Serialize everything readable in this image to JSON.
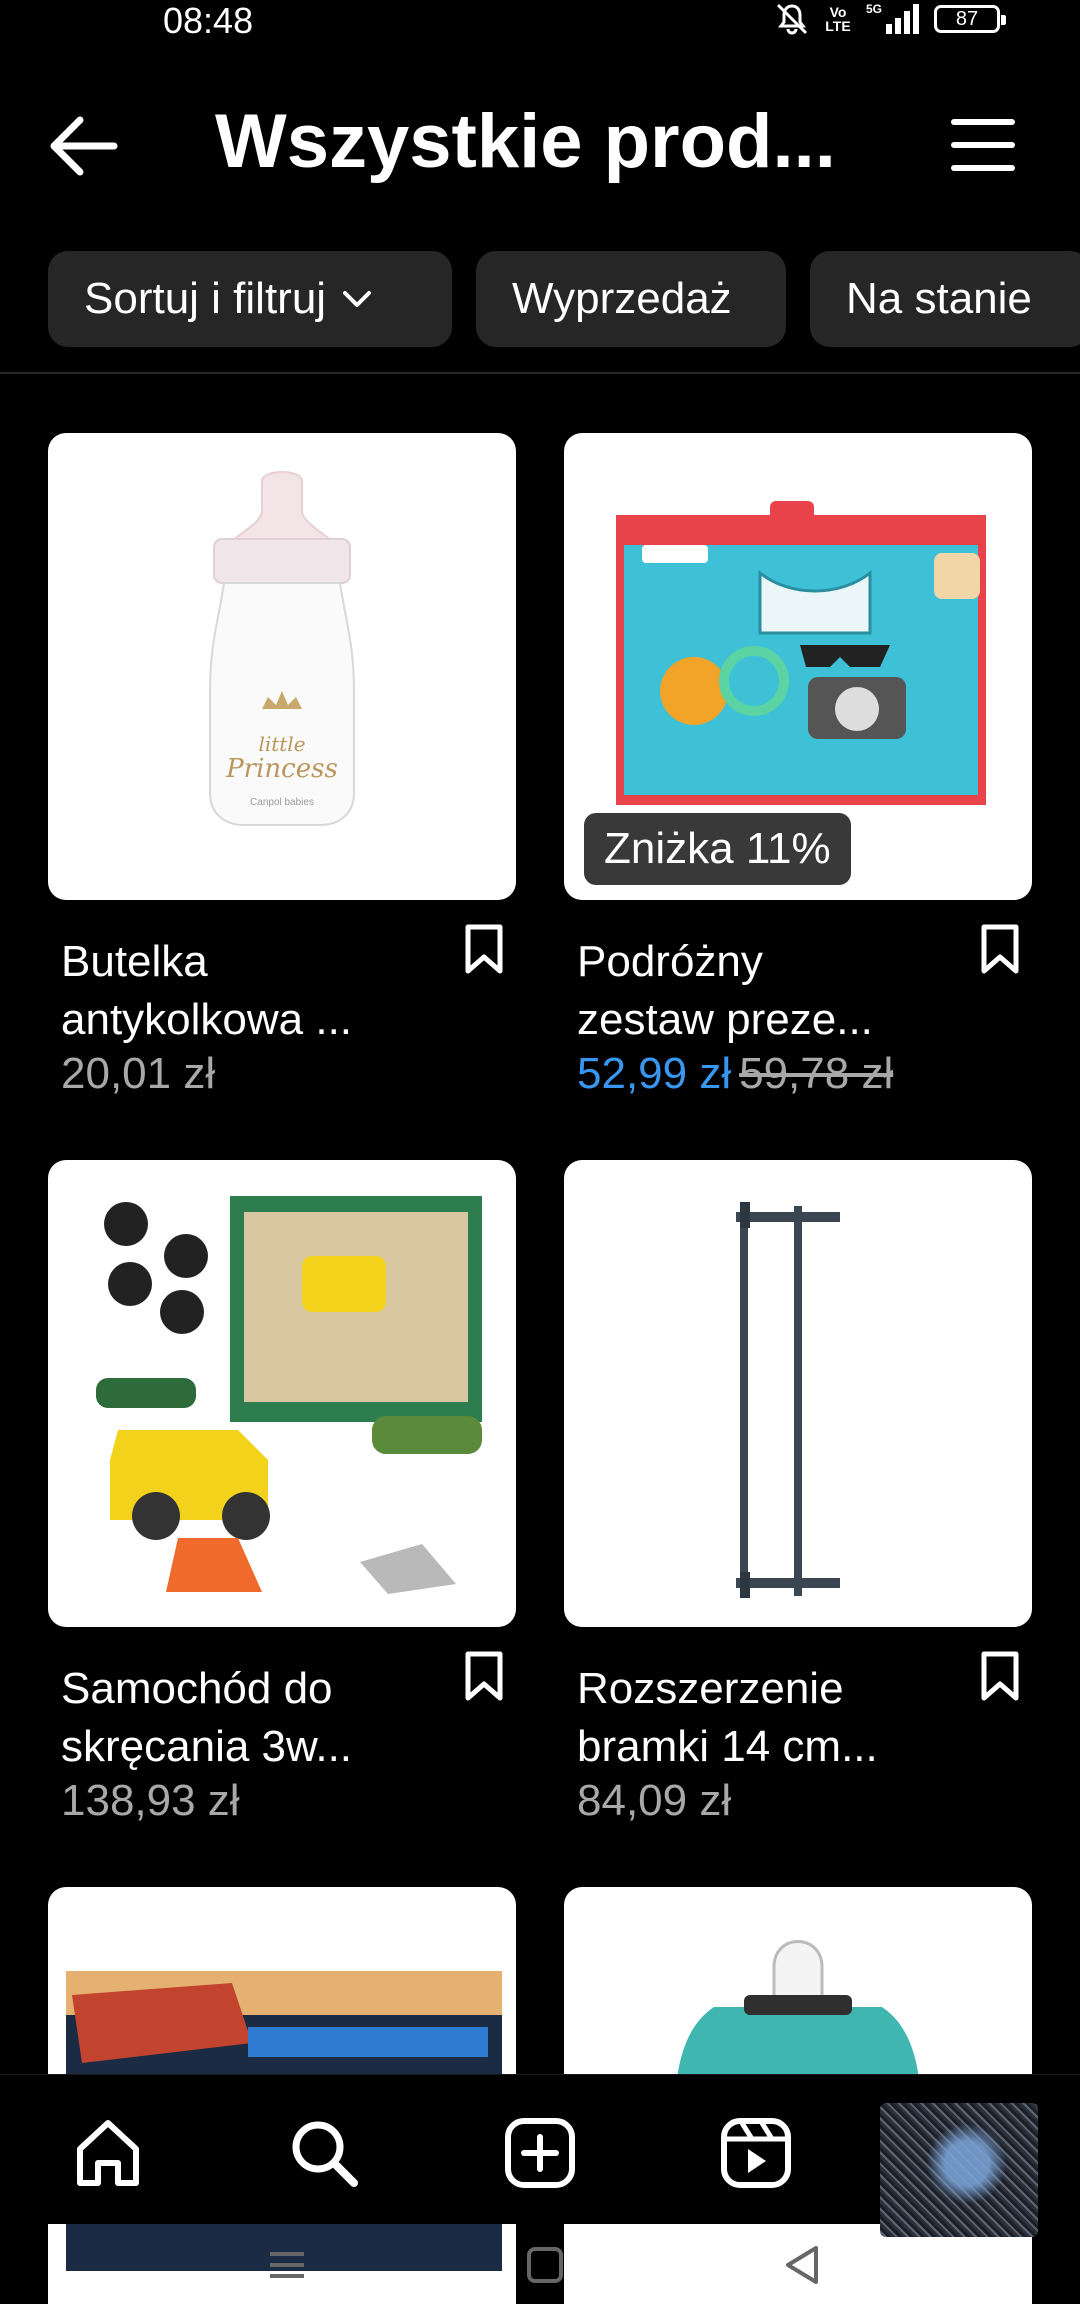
{
  "status_bar": {
    "time": "08:48",
    "volte": "Vo LTE",
    "network": "5G",
    "battery": "87",
    "icons": [
      "mute-icon",
      "volte-icon",
      "signal-icon",
      "battery-icon"
    ]
  },
  "header": {
    "title": "Wszystkie prod...",
    "back_icon": "arrow-left-icon",
    "menu_icon": "hamburger-menu-icon"
  },
  "chips": {
    "sort": "Sortuj i filtruj",
    "sale": "Wyprzedaż",
    "stock": "Na stanie"
  },
  "products": [
    {
      "name_line1": "Butelka",
      "name_line2": "antykolkowa ...",
      "price": "20,01 zł",
      "image": "baby-bottle-little-princess"
    },
    {
      "name_line1": "Podróżny",
      "name_line2": "zestaw preze...",
      "sale_price": "52,99 zł",
      "old_price": "59,78 zł",
      "badge": "Zniżka 11%",
      "image": "fisher-price-gift-set"
    },
    {
      "name_line1": "Samochód do",
      "name_line2": "skręcania 3w...",
      "price": "138,93 zł",
      "image": "toy-car-screw-set"
    },
    {
      "name_line1": "Rozszerzenie",
      "name_line2": "bramki 14 cm...",
      "price": "84,09 zł",
      "image": "safety-gate-extension"
    },
    {
      "image": "monster-jam-toy"
    },
    {
      "image": "teal-sippy-cup"
    }
  ],
  "bottom_nav": [
    "home-icon",
    "search-icon",
    "create-icon",
    "reels-icon",
    "profile-avatar"
  ],
  "system_nav": [
    "recents-icon",
    "home-button-icon",
    "back-triangle-icon"
  ],
  "colors": {
    "background": "#000000",
    "chip": "#262626",
    "sale_price": "#3897f0",
    "muted_text": "#a8a8a8"
  }
}
